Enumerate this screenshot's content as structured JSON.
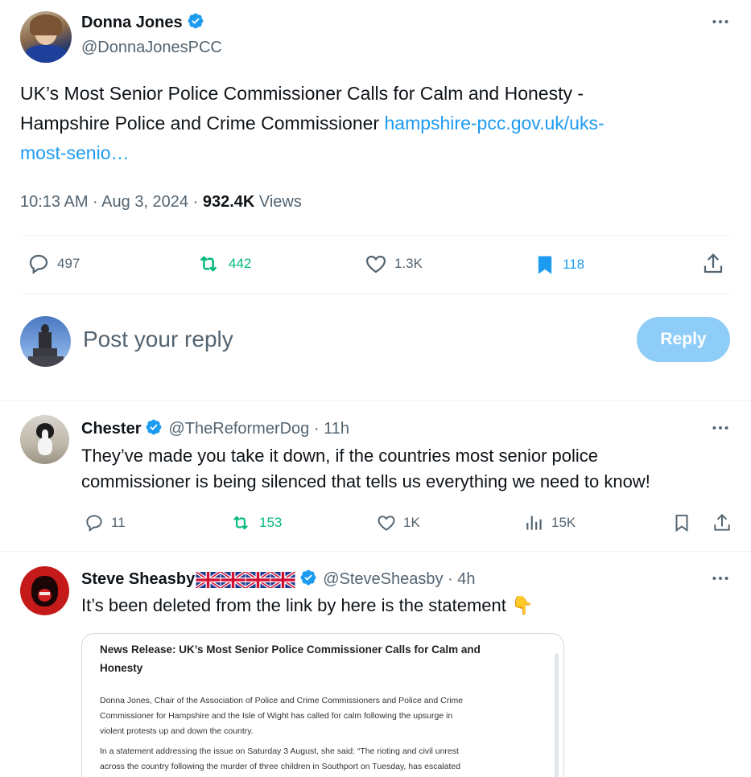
{
  "tweet": {
    "author_name": "Donna Jones",
    "author_handle": "@DonnaJonesPCC",
    "text_line1": "UK’s Most Senior Police Commissioner Calls for Calm and Honesty -",
    "text_line2": "Hampshire Police and Crime Commissioner ",
    "link_part1": "hampshire-pcc.gov.uk/uks-",
    "link_part2": "most-senio…",
    "timestamp": "10:13 AM · Aug 3, 2024 · ",
    "views_count": "932.4K",
    "views_label": " Views",
    "stats": {
      "replies": "497",
      "reposts": "442",
      "likes": "1.3K",
      "bookmarks": "118"
    },
    "more_icon": "more-horizontal-icon"
  },
  "composer": {
    "placeholder": "Post your reply",
    "button_label": "Reply"
  },
  "replies": [
    {
      "author_name": "Chester",
      "author_handle": "@TheReformerDog · 11h",
      "text_line1": "They’ve made you take it down, if the countries most senior police",
      "text_line2": "commissioner is being silenced that tells us everything we need to know!",
      "stats": {
        "replies": "11",
        "reposts": "153",
        "likes": "1K",
        "views": "15K"
      }
    },
    {
      "author_name": "Steve Sheasby",
      "author_flags": "🇬🇧🇬🇧🇬🇧🇬🇧",
      "author_handle": "@SteveSheasby · 4h",
      "text": "It’s been deleted from the link by here is the statement ",
      "emoji": "👇",
      "attachment": {
        "title_line1": "News Release: UK’s Most Senior Police Commissioner Calls for Calm and",
        "title_line2": "Honesty",
        "p1_line1": "Donna Jones, Chair of the Association of Police and Crime Commissioners and Police and Crime",
        "p1_line2": "Commissioner for Hampshire and the Isle of Wight has called for calm following the upsurge in",
        "p1_line3": "violent protests up and down the country.",
        "p2_line1": "In a statement addressing the issue on Saturday 3 August, she said: “The rioting and civil unrest",
        "p2_line2": "across the country following the murder of three children in Southport on Tuesday, has escalated"
      }
    }
  ],
  "colors": {
    "accent": "#1d9bf0",
    "repost_green": "#00ba7c",
    "reply_button_disabled": "#8ecdf8",
    "text_secondary": "#536471",
    "divider": "#eff3f4"
  }
}
